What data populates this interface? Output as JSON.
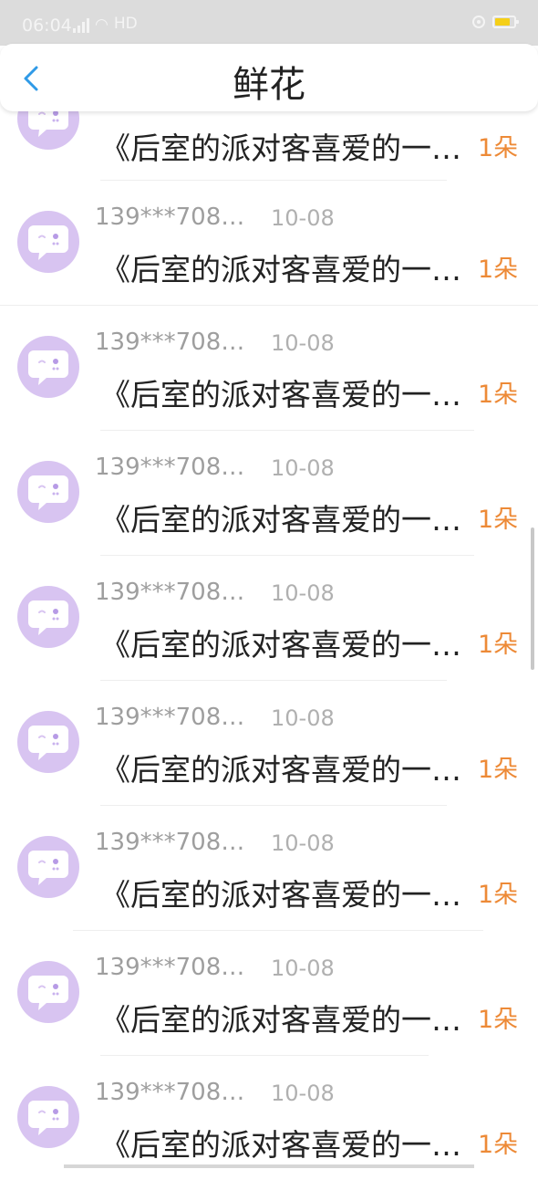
{
  "status": {
    "time": "06:04",
    "network": "4G",
    "hd": "HD"
  },
  "header": {
    "title": "鲜花"
  },
  "colors": {
    "accent": "#2f9ae7",
    "count": "#ed8a37",
    "avatar_bg": "#d8c4f1"
  },
  "icons": {
    "back": "chevron-left-icon",
    "avatar": "chat-bubble-face-icon"
  },
  "items": [
    {
      "title": "《后室的派对客喜爱的一…",
      "count": "1朵"
    },
    {
      "user": "139***708…",
      "date": "10-08",
      "title": "《后室的派对客喜爱的一…",
      "count": "1朵"
    },
    {
      "user": "139***708…",
      "date": "10-08",
      "title": "《后室的派对客喜爱的一…",
      "count": "1朵"
    },
    {
      "user": "139***708…",
      "date": "10-08",
      "title": "《后室的派对客喜爱的一…",
      "count": "1朵"
    },
    {
      "user": "139***708…",
      "date": "10-08",
      "title": "《后室的派对客喜爱的一…",
      "count": "1朵"
    },
    {
      "user": "139***708…",
      "date": "10-08",
      "title": "《后室的派对客喜爱的一…",
      "count": "1朵"
    },
    {
      "user": "139***708…",
      "date": "10-08",
      "title": "《后室的派对客喜爱的一…",
      "count": "1朵"
    },
    {
      "user": "139***708…",
      "date": "10-08",
      "title": "《后室的派对客喜爱的一…",
      "count": "1朵"
    },
    {
      "user": "139***708…",
      "date": "10-08",
      "title": "《后室的派对客喜爱的一…",
      "count": "1朵"
    }
  ]
}
